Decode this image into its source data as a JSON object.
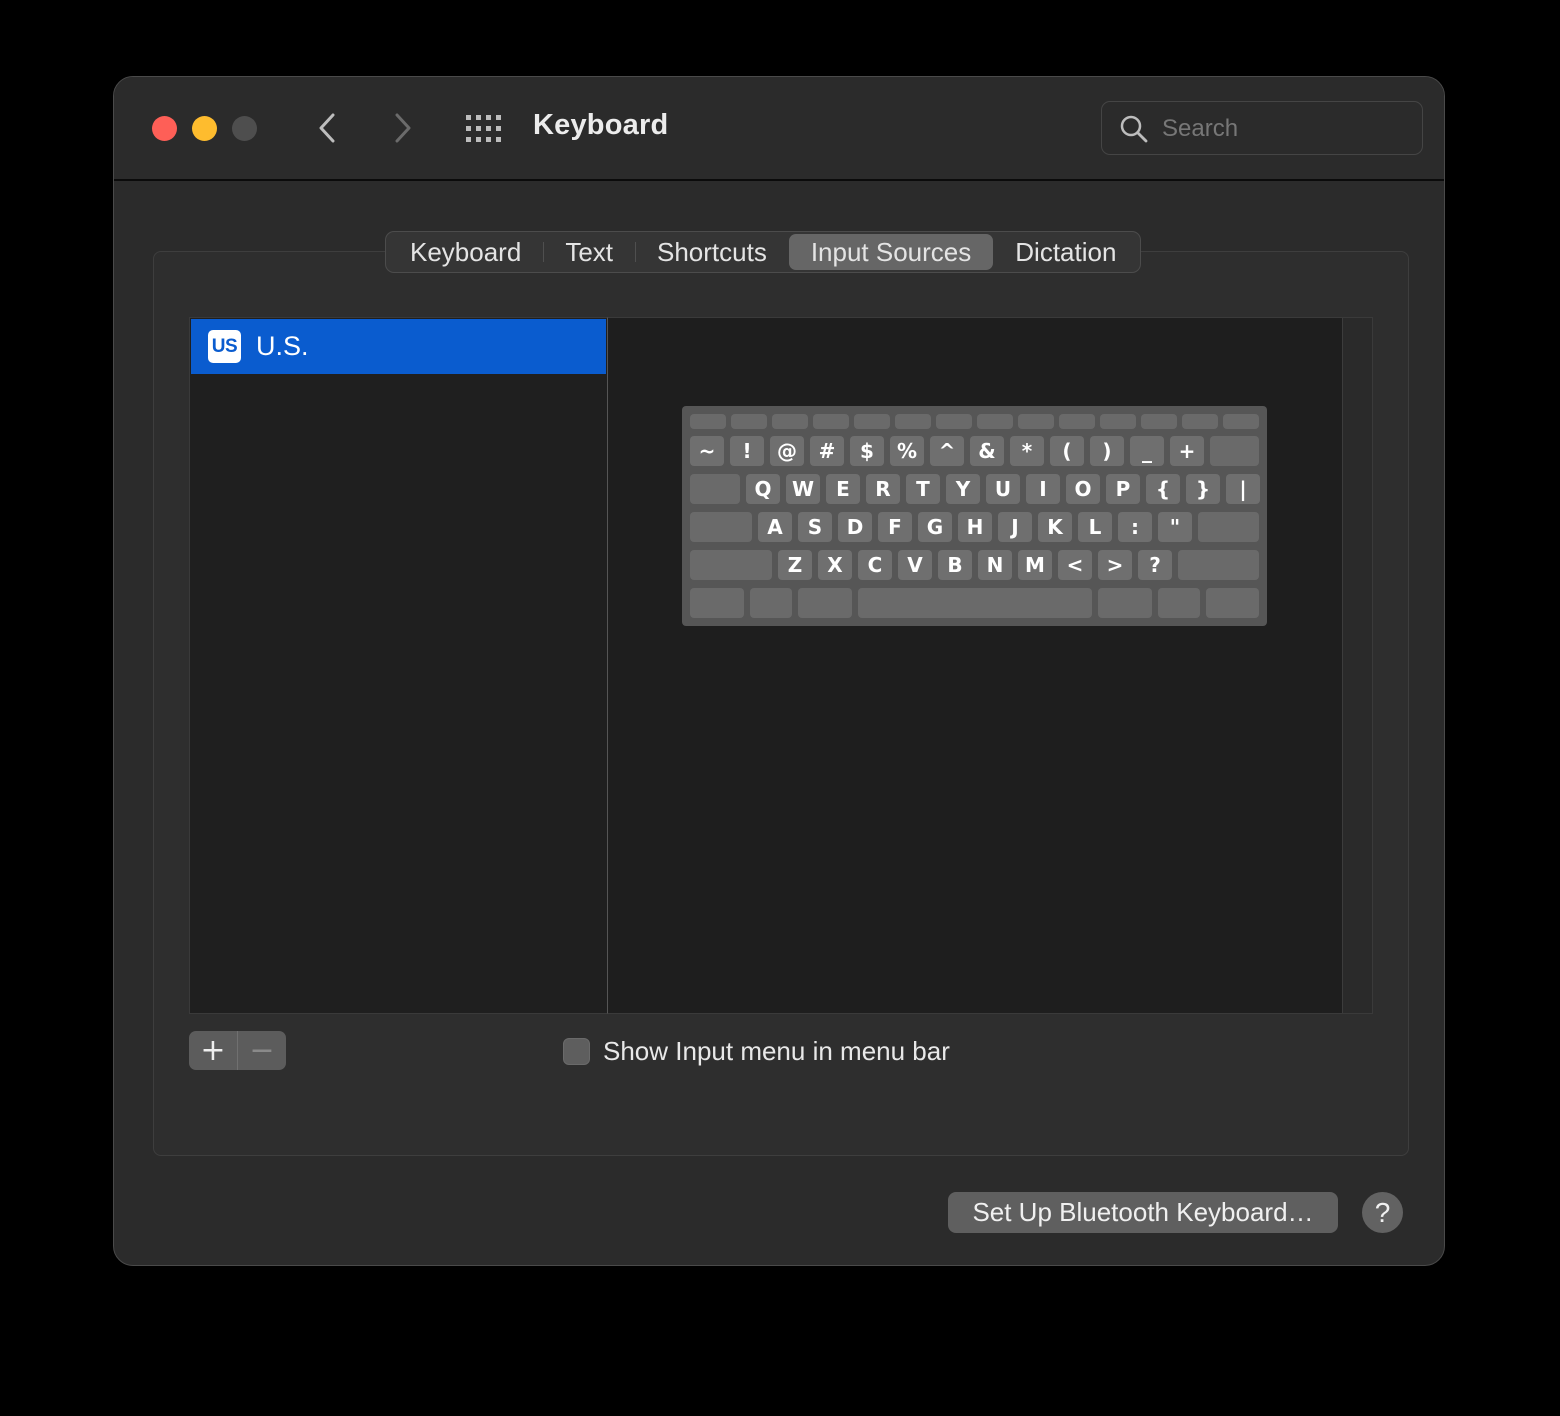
{
  "window": {
    "title": "Keyboard"
  },
  "titlebar": {
    "traffic_lights": {
      "close": "#fe5f57",
      "minimize": "#febc2e",
      "zoom": "#4e4e4e"
    },
    "back_icon": "chevron-left-icon",
    "forward_icon": "chevron-right-icon",
    "show_all_icon": "grid-icon"
  },
  "search": {
    "placeholder": "Search",
    "value": ""
  },
  "tabs": [
    {
      "label": "Keyboard",
      "active": false
    },
    {
      "label": "Text",
      "active": false
    },
    {
      "label": "Shortcuts",
      "active": false
    },
    {
      "label": "Input Sources",
      "active": true
    },
    {
      "label": "Dictation",
      "active": false
    }
  ],
  "sources": {
    "items": [
      {
        "badge": "US",
        "label": "U.S.",
        "selected": true
      }
    ],
    "selection_color": "#0a5ccf"
  },
  "keyboard_preview": {
    "rows": [
      [
        "~",
        "!",
        "@",
        "#",
        "$",
        "%",
        "^",
        "&",
        "*",
        "(",
        ")",
        "_",
        "+"
      ],
      [
        "Q",
        "W",
        "E",
        "R",
        "T",
        "Y",
        "U",
        "I",
        "O",
        "P",
        "{",
        "}",
        "|"
      ],
      [
        "A",
        "S",
        "D",
        "F",
        "G",
        "H",
        "J",
        "K",
        "L",
        ":",
        "\""
      ],
      [
        "Z",
        "X",
        "C",
        "V",
        "B",
        "N",
        "M",
        "<",
        ">",
        "?"
      ]
    ]
  },
  "controls": {
    "add_label": "+",
    "remove_label": "−",
    "show_input_menu_label": "Show Input menu in menu bar",
    "show_input_menu_checked": false
  },
  "footer": {
    "bluetooth_button": "Set Up Bluetooth Keyboard…",
    "help_label": "?"
  }
}
